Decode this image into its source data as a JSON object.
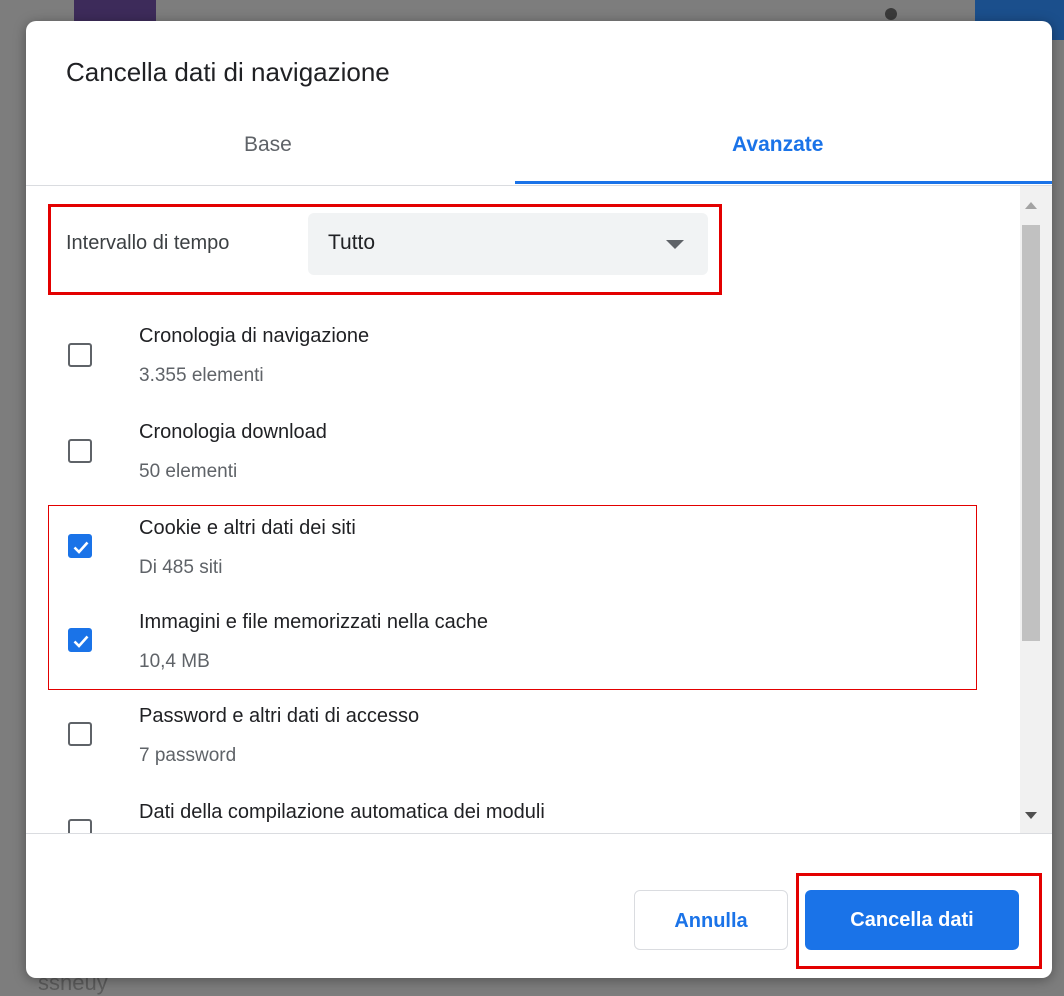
{
  "background": {
    "bottom_text": "ssheuy"
  },
  "dialog": {
    "title": "Cancella dati di navigazione",
    "tabs": [
      {
        "label": "Base",
        "selected": false
      },
      {
        "label": "Avanzate",
        "selected": true
      }
    ],
    "time_range": {
      "label": "Intervallo di tempo",
      "value": "Tutto"
    },
    "items": [
      {
        "title": "Cronologia di navigazione",
        "subtitle": "3.355 elementi",
        "checked": false
      },
      {
        "title": "Cronologia download",
        "subtitle": "50 elementi",
        "checked": false
      },
      {
        "title": "Cookie e altri dati dei siti",
        "subtitle": "Di 485 siti",
        "checked": true
      },
      {
        "title": "Immagini e file memorizzati nella cache",
        "subtitle": "10,4 MB",
        "checked": true
      },
      {
        "title": "Password e altri dati di accesso",
        "subtitle": "7 password",
        "checked": false
      },
      {
        "title": "Dati della compilazione automatica dei moduli",
        "subtitle": "",
        "checked": false
      }
    ],
    "buttons": {
      "cancel": "Annulla",
      "confirm": "Cancella dati"
    }
  },
  "colors": {
    "accent": "#1a73e8",
    "highlight": "#e30000"
  }
}
